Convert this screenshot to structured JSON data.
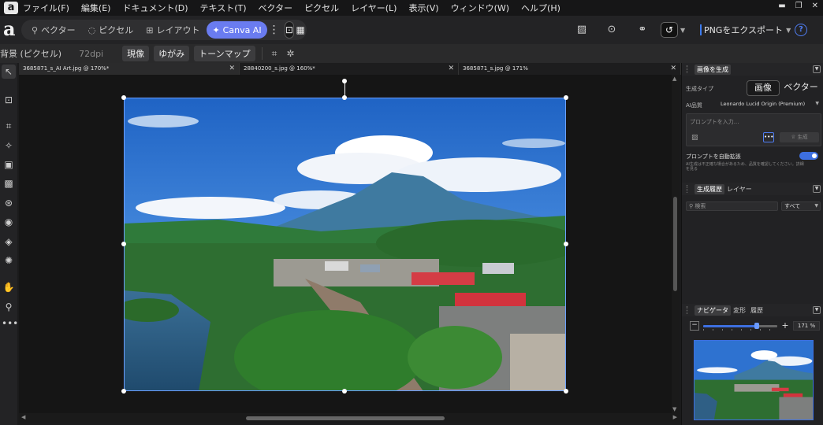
{
  "menu": {
    "items": [
      "ファイル(F)",
      "編集(E)",
      "ドキュメント(D)",
      "テキスト(T)",
      "ベクター",
      "ピクセル",
      "レイヤー(L)",
      "表示(V)",
      "ウィンドウ(W)",
      "ヘルプ(H)"
    ]
  },
  "toolbar": {
    "personas": {
      "vector": "ベクター",
      "pixel": "ピクセル",
      "layout": "レイアウト",
      "canva_ai": "Canva AI"
    },
    "export_label": "PNGをエクスポート"
  },
  "context": {
    "layer_label": "背景 (ピクセル)",
    "dpi": "72dpi",
    "develop": "現像",
    "distort": "ゆがみ",
    "tonemap": "トーンマップ"
  },
  "tabs": [
    {
      "title": "3685871_s_AI Art.jpg @ 170%*",
      "active": true
    },
    {
      "title": "28840200_s.jpg @ 160%*",
      "active": false
    },
    {
      "title": "3685871_s.jpg @ 171%",
      "active": false
    }
  ],
  "gen_panel": {
    "header": "画像を生成",
    "gen_type_label": "生成タイプ",
    "type_image": "画像",
    "type_vector": "ベクター",
    "model_label": "AI品質",
    "model_value": "Leonardo Lucid Origin (Premium)",
    "prompt_placeholder": "プロンプトを入力...",
    "generate_label": "生成",
    "auto_prompt_label": "プロンプトを自動拡張",
    "note": "AI生成は不正確な場合があるため、品質を確認してください。詳細を見る"
  },
  "history_panel": {
    "tab_history": "生成履歴",
    "tab_layers": "レイヤー",
    "search_placeholder": "検索",
    "filter_value": "すべて"
  },
  "nav_panel": {
    "tab_navigator": "ナビゲータ",
    "tab_transform": "変形",
    "tab_history": "履歴",
    "zoom_value": "171 %",
    "zoom_fraction": 0.72
  },
  "colors": {
    "accent": "#6a7cf0",
    "selection": "#6aa0ff",
    "toggle": "#3d6fe0"
  }
}
